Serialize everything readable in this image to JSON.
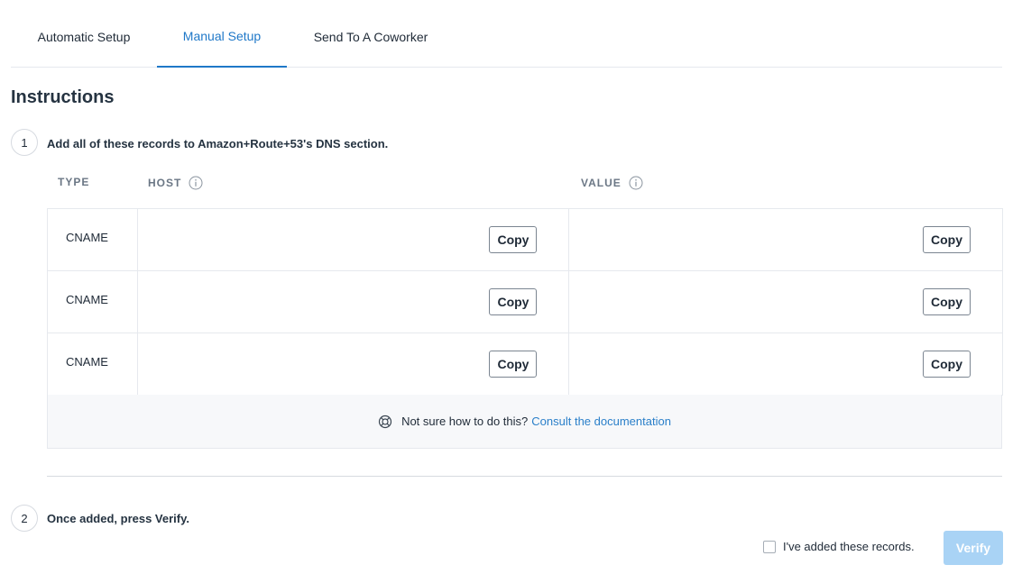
{
  "tabs": [
    {
      "label": "Automatic Setup",
      "active": false
    },
    {
      "label": "Manual Setup",
      "active": true
    },
    {
      "label": "Send To A Coworker",
      "active": false
    }
  ],
  "section_title": "Instructions",
  "step1": {
    "number": "1",
    "text": "Add all of these records to Amazon+Route+53's DNS section."
  },
  "columns": {
    "type": "TYPE",
    "host": "HOST",
    "value": "VALUE"
  },
  "records": [
    {
      "type": "CNAME",
      "host": "",
      "value": "",
      "copy_label": "Copy"
    },
    {
      "type": "CNAME",
      "host": "",
      "value": "",
      "copy_label": "Copy"
    },
    {
      "type": "CNAME",
      "host": "",
      "value": "",
      "copy_label": "Copy"
    }
  ],
  "help": {
    "text": "Not sure how to do this?",
    "link": "Consult the documentation",
    "icon": "lifebuoy-icon"
  },
  "step2": {
    "number": "2",
    "text": "Once added, press Verify."
  },
  "confirm_label": "I've added these records.",
  "verify_label": "Verify",
  "colors": {
    "accent": "#1f78c8",
    "link": "#2a7fc9",
    "verify_disabled": "#a9d3f5"
  }
}
